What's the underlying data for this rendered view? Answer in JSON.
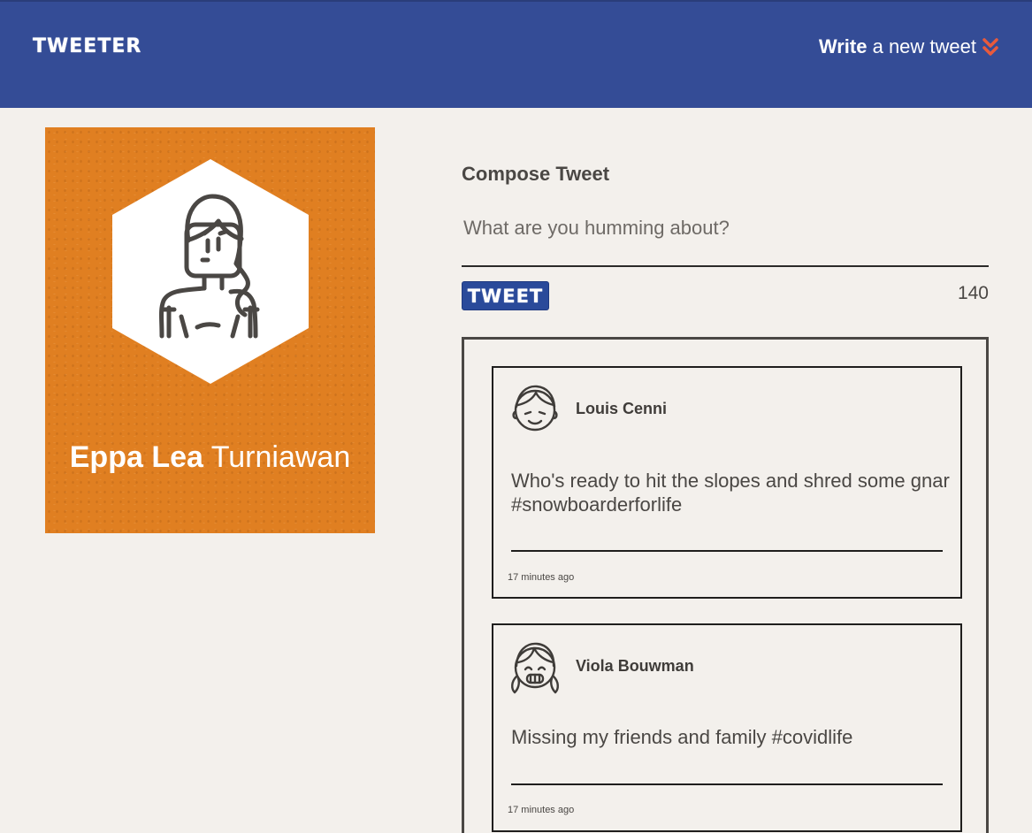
{
  "nav": {
    "brand": "TWEETER",
    "write_bold": "Write",
    "write_rest": " a new tweet",
    "chevron_icon": "double-chevron-down-icon",
    "chevron_color": "#e85a3c"
  },
  "colors": {
    "nav_background": "#344c96",
    "profile_background": "#e07f21",
    "tweet_button": "#2a4a9a"
  },
  "profile": {
    "first_name": "Eppa Lea",
    "last_name": " Turniawan",
    "avatar_icon": "woman-avatar-icon"
  },
  "compose": {
    "title": "Compose Tweet",
    "placeholder": "What are you humming about?",
    "button_label": "TWEET",
    "counter": "140"
  },
  "tweets": [
    {
      "name": "Louis Cenni",
      "avatar_icon": "boy-avatar-icon",
      "text": "Who's ready to hit the slopes and shred some gnar #snowboarderforlife",
      "time": "17 minutes ago"
    },
    {
      "name": "Viola Bouwman",
      "avatar_icon": "girl-avatar-icon",
      "text": "Missing my friends and family #covidlife",
      "time": "17 minutes ago"
    }
  ]
}
